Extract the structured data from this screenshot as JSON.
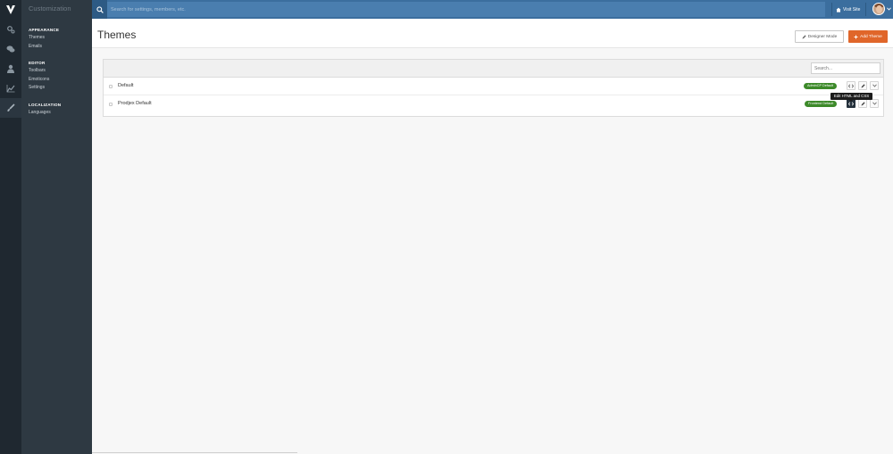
{
  "app": {
    "section_title": "Customization",
    "colors": {
      "rail": "#1f2830",
      "sidebar": "#2e3942",
      "topbar": "#3b6e9e",
      "accent": "#e0662a",
      "badge": "#3d8a2a"
    }
  },
  "rail": {
    "items": [
      {
        "icon": "gears-icon"
      },
      {
        "icon": "comments-icon"
      },
      {
        "icon": "user-icon"
      },
      {
        "icon": "chart-line-icon"
      },
      {
        "icon": "paintbrush-icon",
        "active": true
      }
    ]
  },
  "sidebar": {
    "sections": [
      {
        "heading": "APPEARANCE",
        "items": [
          "Themes",
          "Emails"
        ]
      },
      {
        "heading": "EDITOR",
        "items": [
          "Toolbars",
          "Emoticons",
          "Settings"
        ]
      },
      {
        "heading": "LOCALIZATION",
        "items": [
          "Languages"
        ]
      }
    ]
  },
  "topbar": {
    "search_placeholder": "Search for settings, members, etc.",
    "visit_site": "Visit Site"
  },
  "page": {
    "title": "Themes",
    "designer_mode": "Designer Mode",
    "add_theme": "Add Theme"
  },
  "themes": {
    "filter_placeholder": "Search...",
    "rows": [
      {
        "name": "Default",
        "badge": "AdminCP Default"
      },
      {
        "name": "Prodjex Default",
        "badge": "Frontend Default"
      }
    ],
    "tooltip": "Edit HTML and CSS"
  }
}
